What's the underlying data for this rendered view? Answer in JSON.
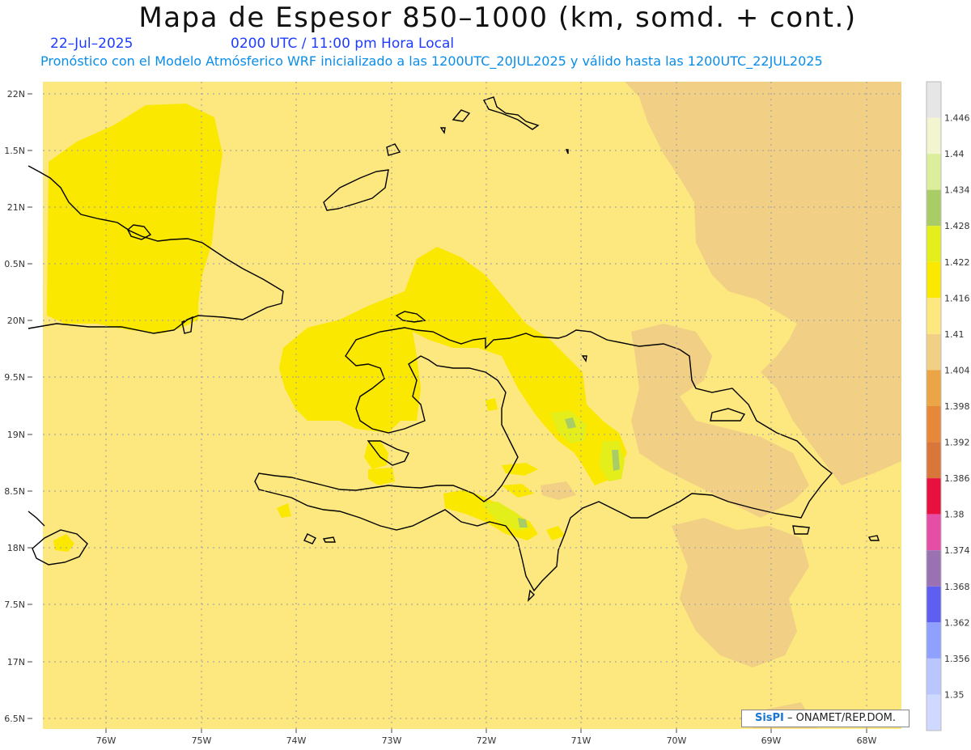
{
  "header": {
    "title": "Mapa de Espesor 850–1000 (km, somd. + cont.)",
    "date": "22–Jul–2025",
    "time": "0200 UTC / 11:00 pm Hora Local",
    "subtitle": "Pronóstico con el Modelo Atmósferico WRF inicializado a las 1200UTC_20JUL2025 y válido hasta las  1200UTC_22JUL2025"
  },
  "axes": {
    "lat_labels": [
      "22N",
      "1.5N",
      "21N",
      "0.5N",
      "20N",
      "9.5N",
      "19N",
      "8.5N",
      "18N",
      "7.5N",
      "17N",
      "6.5N"
    ],
    "lon_labels": [
      "76W",
      "75W",
      "74W",
      "73W",
      "72W",
      "71W",
      "70W",
      "69W",
      "68W"
    ]
  },
  "legend": {
    "levels": [
      "1.446",
      "1.44",
      "1.434",
      "1.428",
      "1.422",
      "1.416",
      "1.41",
      "1.404",
      "1.398",
      "1.392",
      "1.386",
      "1.38",
      "1.374",
      "1.368",
      "1.362",
      "1.356",
      "1.35"
    ],
    "colors": [
      "#e6e6e6",
      "#f2f5cf",
      "#dbee9c",
      "#a9cc66",
      "#e4ee1a",
      "#fae800",
      "#fde87f",
      "#f1cf84",
      "#eba446",
      "#e5883a",
      "#d9773a",
      "#e8103f",
      "#e44ea5",
      "#9a71b1",
      "#5e5ef0",
      "#8fa0ff",
      "#b9c6ff"
    ]
  },
  "field_colors": {
    "base": "#fde87f",
    "high": "#fae800",
    "higher": "#e4ee1a",
    "peak": "#a9cc66",
    "low": "#f1cf84",
    "coast": "#000000"
  },
  "credit": {
    "logo": "SisPI",
    "text": "– ONAMET/REP.DOM."
  }
}
